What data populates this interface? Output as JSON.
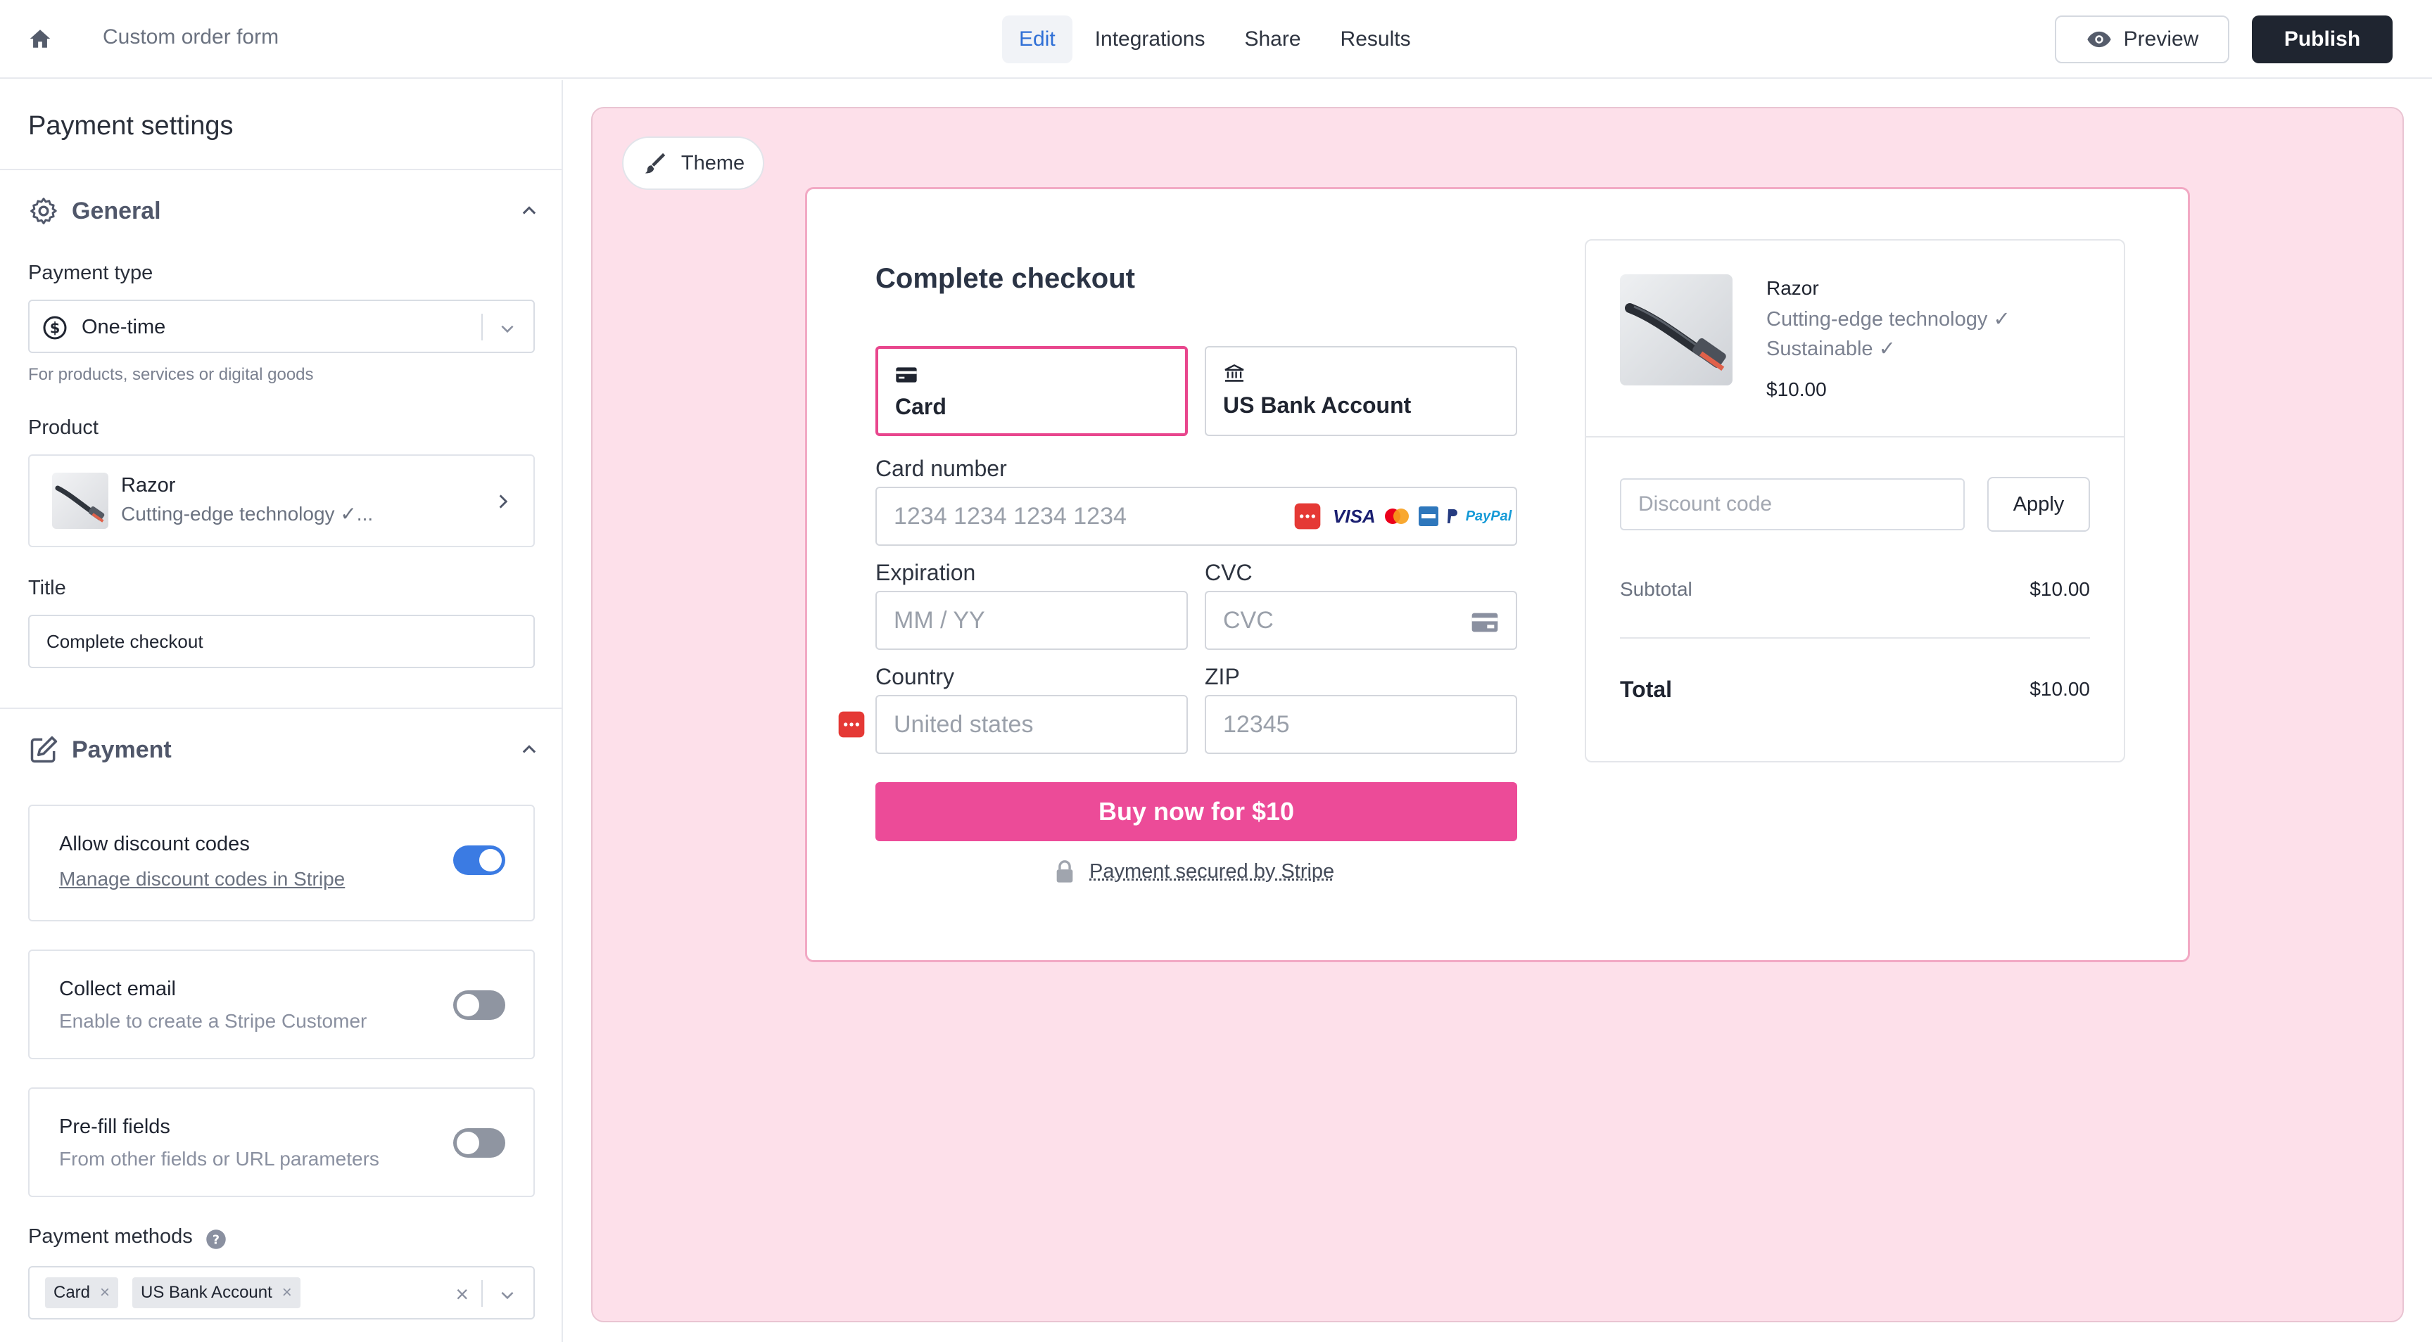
{
  "header": {
    "form_name": "Custom order form",
    "tabs": [
      {
        "label": "Edit",
        "active": true
      },
      {
        "label": "Integrations",
        "active": false
      },
      {
        "label": "Share",
        "active": false
      },
      {
        "label": "Results",
        "active": false
      }
    ],
    "preview_label": "Preview",
    "publish_label": "Publish"
  },
  "sidebar": {
    "title": "Payment settings",
    "general": {
      "label": "General",
      "payment_type_label": "Payment type",
      "payment_type_value": "One-time",
      "payment_type_help": "For products, services or digital goods",
      "product_label": "Product",
      "product_name": "Razor",
      "product_desc": "Cutting-edge technology ✓...",
      "title_label": "Title",
      "title_value": "Complete checkout"
    },
    "payment": {
      "label": "Payment",
      "toggles": [
        {
          "title": "Allow discount codes",
          "link": "Manage discount codes in Stripe",
          "on": true
        },
        {
          "title": "Collect email",
          "subtitle": "Enable to create a Stripe Customer",
          "on": false
        },
        {
          "title": "Pre-fill fields",
          "subtitle": "From other fields or URL parameters",
          "on": false
        }
      ],
      "methods_label": "Payment methods",
      "methods": [
        "Card",
        "US Bank Account"
      ]
    }
  },
  "canvas": {
    "theme_label": "Theme",
    "background_color": "#fde0ea",
    "accent_color": "#ec4b98",
    "checkout": {
      "title": "Complete checkout",
      "tabs": [
        {
          "label": "Card",
          "icon": "credit-card-icon",
          "selected": true
        },
        {
          "label": "US Bank Account",
          "icon": "bank-icon",
          "selected": false
        }
      ],
      "card_number_label": "Card number",
      "card_number_placeholder": "1234 1234 1234 1234",
      "card_brands": [
        "VISA",
        "Mastercard",
        "American Express",
        "PayPal"
      ],
      "visa_text": "VISA",
      "paypal_text": "PayPal",
      "expiration_label": "Expiration",
      "expiration_placeholder": "MM / YY",
      "cvc_label": "CVC",
      "cvc_placeholder": "CVC",
      "country_label": "Country",
      "country_value": "United states",
      "zip_label": "ZIP",
      "zip_placeholder": "12345",
      "buy_label": "Buy now for $10",
      "secured_label": "Payment secured by Stripe"
    },
    "summary": {
      "product_name": "Razor",
      "features": [
        "Cutting-edge technology ✓",
        "Sustainable ✓"
      ],
      "price": "$10.00",
      "discount_placeholder": "Discount code",
      "apply_label": "Apply",
      "subtotal_label": "Subtotal",
      "subtotal_value": "$10.00",
      "total_label": "Total",
      "total_value": "$10.00"
    }
  }
}
